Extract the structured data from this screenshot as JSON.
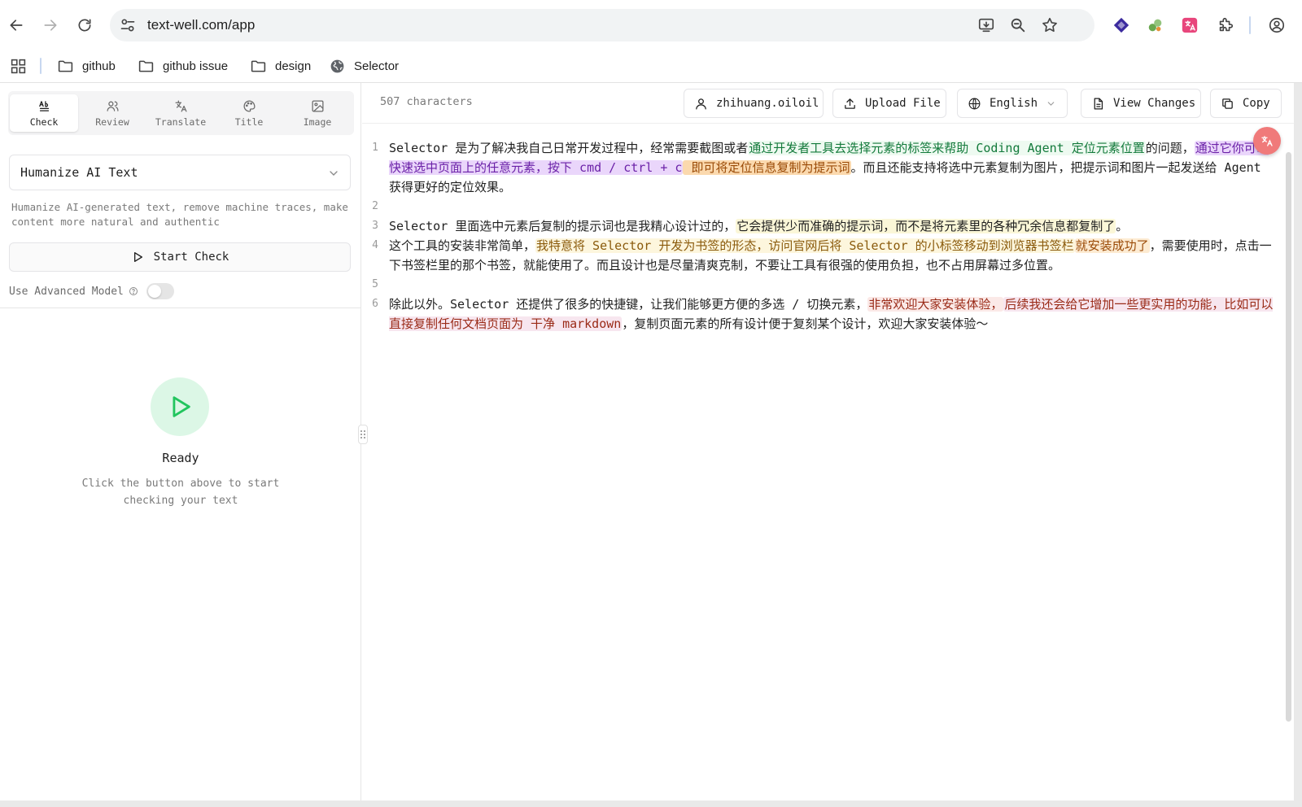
{
  "browser": {
    "url": "text-well.com/app",
    "bookmarks": [
      {
        "label": "github",
        "icon": "folder-icon"
      },
      {
        "label": "github issue",
        "icon": "folder-icon"
      },
      {
        "label": "design",
        "icon": "folder-icon"
      },
      {
        "label": "Selector",
        "icon": "globe-icon"
      }
    ]
  },
  "sidebar": {
    "tabs": [
      {
        "label": "Check",
        "icon": "spellcheck-icon",
        "active": true
      },
      {
        "label": "Review",
        "icon": "users-icon"
      },
      {
        "label": "Translate",
        "icon": "translate-icon"
      },
      {
        "label": "Title",
        "icon": "palette-icon"
      },
      {
        "label": "Image",
        "icon": "image-icon"
      }
    ],
    "mode_select": {
      "value": "Humanize AI Text"
    },
    "description": "Humanize AI-generated text, remove machine traces, make content more natural and authentic",
    "start_button": "Start Check",
    "advanced_model_label": "Use Advanced Model",
    "advanced_model_enabled": false,
    "status": {
      "title": "Ready",
      "subtitle": "Click the button above to start checking your text"
    }
  },
  "editor_header": {
    "char_count": "507 characters",
    "user_button": "zhihuang.oiloil",
    "upload_button": "Upload File",
    "language_select": "English",
    "view_changes_button": "View Changes",
    "copy_button": "Copy"
  },
  "editor": {
    "line_numbers": [
      "1",
      "2",
      "3",
      "4",
      "5",
      "6"
    ],
    "line1": {
      "p1": "Selector 是为了解决我自己日常开发过程中，经常需要截图或者",
      "h1": "通过开发者工具去选择元素的标签来帮助 Coding Agent 定位元素位置",
      "p2": "的问题，",
      "h2": "通过它你可以快速选中页面上的任意元素，按下 cmd / ctrl + c",
      "h3": " 即可将定位信息复制为提示词",
      "p3": "。而且还能支持将选中元素复制为图片，把提示词和图片一起发送给 Agent 获得更好的定位效果。"
    },
    "line3": {
      "p1": "Selector 里面选中元素后复制的提示词也是我精心设计过的，",
      "h1": "它会提供少而准确的提示词，而不是将元素里的各种冗余信息都复制了",
      "p2": "。"
    },
    "line4": {
      "p1": "这个工具的安装非常简单，",
      "h1": "我特意将 Selector 开发为书签的形态，访问官网后将 Selector 的小标签移动到浏览器书签栏",
      "h2": "就安装成功了",
      "p2": "，需要使用时，点击一下书签栏里的那个书签，就能使用了。而且设计也是尽量清爽克制，不要让工具有很强的使用负担，也不占用屏幕过多位置。"
    },
    "line6": {
      "p1": "除此以外。Selector 还提供了很多的快捷键，让我们能够更方便的多选 / 切换元素，",
      "h1": "非常欢迎大家安装体验，",
      "h2": "后续我还会给它增加一些更实用的功能，比如可以直接复制任何文档页面为 干净 markdown",
      "p2": "，复制页面元素的所有设计便于复刻某个设计，欢迎大家安装体验～"
    }
  },
  "colors": {
    "accent_green": "#22c55e",
    "highlight_purple": "#ead6fb",
    "highlight_orange": "#fbd9ae"
  }
}
